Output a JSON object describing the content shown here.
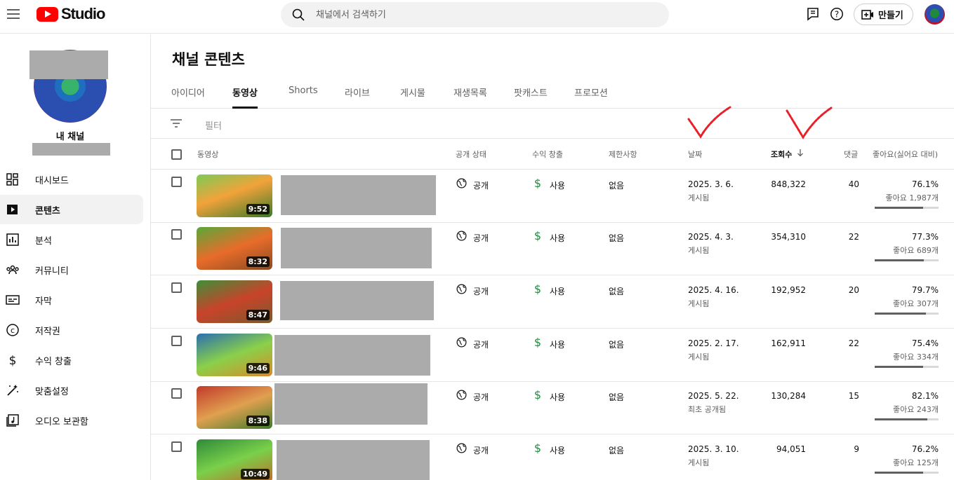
{
  "header": {
    "logo_text": "Studio",
    "search_placeholder": "채널에서 검색하기",
    "create_label": "만들기"
  },
  "sidebar": {
    "channel_label": "내 채널",
    "items": [
      {
        "label": "대시보드",
        "icon": "dashboard-icon"
      },
      {
        "label": "콘텐츠",
        "icon": "content-icon"
      },
      {
        "label": "분석",
        "icon": "analytics-icon"
      },
      {
        "label": "커뮤니티",
        "icon": "community-icon"
      },
      {
        "label": "자막",
        "icon": "subtitles-icon"
      },
      {
        "label": "저작권",
        "icon": "copyright-icon"
      },
      {
        "label": "수익 창출",
        "icon": "dollar-icon"
      },
      {
        "label": "맞춤설정",
        "icon": "customization-icon"
      },
      {
        "label": "오디오 보관함",
        "icon": "audio-library-icon"
      }
    ],
    "active_index": 1
  },
  "main": {
    "title": "채널 콘텐츠",
    "tabs": [
      "아이디어",
      "동영상",
      "Shorts",
      "라이브",
      "게시물",
      "재생목록",
      "팟캐스트",
      "프로모션"
    ],
    "active_tab": 1,
    "filter_label": "필터",
    "columns": {
      "video": "동영상",
      "visibility": "공개 상태",
      "monetization": "수익 창출",
      "restrictions": "제한사항",
      "date": "날짜",
      "views": "조회수",
      "comments": "댓글",
      "likes": "좋아요(싫어요 대비)"
    },
    "rows": [
      {
        "duration": "9:52",
        "visibility": "공개",
        "monetization": "사용",
        "restrictions": "없음",
        "date": "2025. 3. 6.",
        "date_status": "게시됨",
        "views": "848,322",
        "comments": "40",
        "like_pct": "76.1%",
        "like_count": "좋아요 1,987개",
        "like_ratio": 0.761
      },
      {
        "duration": "8:32",
        "visibility": "공개",
        "monetization": "사용",
        "restrictions": "없음",
        "date": "2025. 4. 3.",
        "date_status": "게시됨",
        "views": "354,310",
        "comments": "22",
        "like_pct": "77.3%",
        "like_count": "좋아요 689개",
        "like_ratio": 0.773
      },
      {
        "duration": "8:47",
        "visibility": "공개",
        "monetization": "사용",
        "restrictions": "없음",
        "date": "2025. 4. 16.",
        "date_status": "게시됨",
        "views": "192,952",
        "comments": "20",
        "like_pct": "79.7%",
        "like_count": "좋아요 307개",
        "like_ratio": 0.797
      },
      {
        "duration": "9:46",
        "visibility": "공개",
        "monetization": "사용",
        "restrictions": "없음",
        "date": "2025. 2. 17.",
        "date_status": "게시됨",
        "views": "162,911",
        "comments": "22",
        "like_pct": "75.4%",
        "like_count": "좋아요 334개",
        "like_ratio": 0.754
      },
      {
        "duration": "8:38",
        "visibility": "공개",
        "monetization": "사용",
        "restrictions": "없음",
        "date": "2025. 5. 22.",
        "date_status": "최초 공개됨",
        "views": "130,284",
        "comments": "15",
        "like_pct": "82.1%",
        "like_count": "좋아요 243개",
        "like_ratio": 0.821
      },
      {
        "duration": "10:49",
        "visibility": "공개",
        "monetization": "사용",
        "restrictions": "없음",
        "date": "2025. 3. 10.",
        "date_status": "게시됨",
        "views": "94,051",
        "comments": "9",
        "like_pct": "76.2%",
        "like_count": "좋아요 125개",
        "like_ratio": 0.762
      }
    ]
  },
  "colors": {
    "accent_red": "#ff0000",
    "money_green": "#1e8e3e",
    "annotation_red": "#e8202a"
  }
}
